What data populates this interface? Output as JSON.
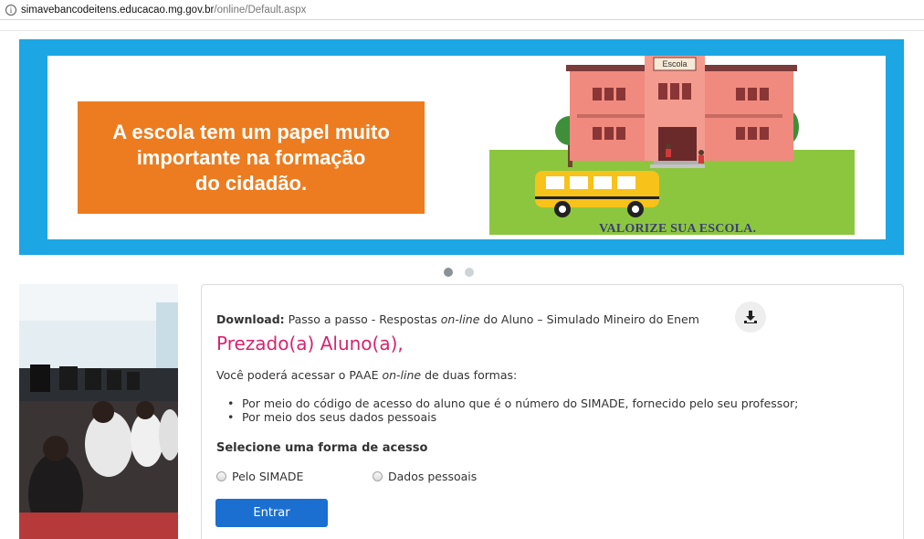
{
  "address_bar": {
    "host": "simavebancodeitens.educacao.mg.gov.br",
    "path": "/online/Default.aspx"
  },
  "banner": {
    "slogan": "A escola tem um papel muito\nimportante na formação\ndo cidadão.",
    "school_sign": "Escola",
    "tagline": "VALORIZE SUA ESCOLA.",
    "colors": {
      "frame": "#1ca6e3",
      "orange": "#ec7c1f",
      "grass": "#8cc63f",
      "building": "#f08a7e"
    }
  },
  "carousel": {
    "slides": 2,
    "active": 1
  },
  "card": {
    "download_label": "Download:",
    "download_text_pre": " Passo a passo - Respostas ",
    "download_text_italic": "on-line",
    "download_text_post": " do Aluno – Simulado Mineiro do Enem",
    "greeting": "Prezado(a) Aluno(a),",
    "intro_pre": "Você poderá acessar o PAAE ",
    "intro_italic": "on-line",
    "intro_post": " de duas formas:",
    "bullets": [
      "Por meio do código de acesso do aluno que é o número do SIMADE, fornecido pelo seu professor;",
      "Por meio dos seus dados pessoais"
    ],
    "select_title": "Selecione uma forma de acesso",
    "options": [
      "Pelo SIMADE",
      "Dados pessoais"
    ],
    "enter_label": "Entrar",
    "accent": "#d6246e",
    "button_color": "#1a6fd1"
  }
}
